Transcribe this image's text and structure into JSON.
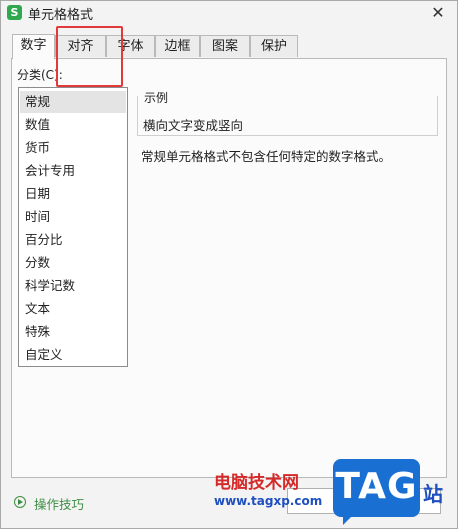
{
  "window": {
    "title": "单元格格式",
    "app_icon": "S"
  },
  "tabs": [
    {
      "label": "数字",
      "active": true
    },
    {
      "label": "对齐",
      "active": false
    },
    {
      "label": "字体",
      "active": false
    },
    {
      "label": "边框",
      "active": false
    },
    {
      "label": "图案",
      "active": false
    },
    {
      "label": "保护",
      "active": false
    }
  ],
  "category": {
    "label": "分类(C):",
    "items": [
      "常规",
      "数值",
      "货币",
      "会计专用",
      "日期",
      "时间",
      "百分比",
      "分数",
      "科学记数",
      "文本",
      "特殊",
      "自定义"
    ],
    "selected": "常规"
  },
  "sample": {
    "title": "示例",
    "text": "横向文字变成竖向"
  },
  "description": "常规单元格格式不包含任何特定的数字格式。",
  "footer": {
    "tips_label": "操作技巧"
  },
  "watermark": {
    "site_cn": "电脑技术网",
    "url": "www.tagxp.com",
    "logo": "TAG",
    "suffix": "站"
  },
  "colors": {
    "highlight_box": "#e23a3a",
    "tips_green": "#3d8d42",
    "logo_blue": "#1a6fd2"
  }
}
